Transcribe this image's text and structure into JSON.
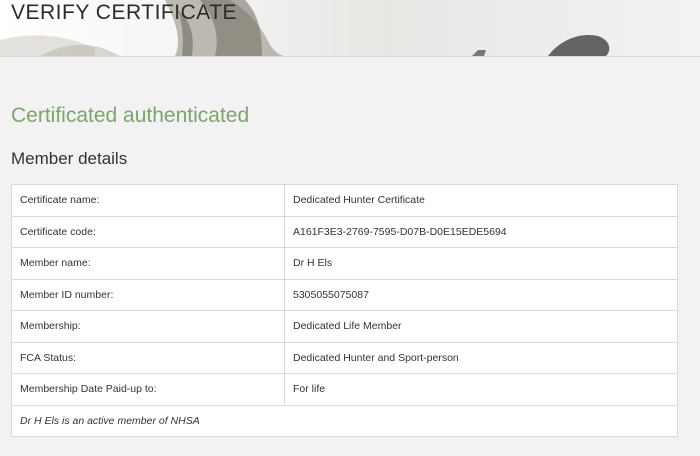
{
  "page": {
    "title": "VERIFY CERTIFICATE",
    "status_heading": "Certificated authenticated",
    "section_heading": "Member details"
  },
  "member_details": {
    "rows": [
      {
        "label": "Certificate name:",
        "value": "Dedicated Hunter Certificate"
      },
      {
        "label": "Certificate code:",
        "value": "A161F3E3-2769-7595-D07B-D0E15EDE5694"
      },
      {
        "label": "Member name:",
        "value": "Dr H Els"
      },
      {
        "label": "Member ID number:",
        "value": "5305055075087"
      },
      {
        "label": "Membership:",
        "value": "Dedicated Life Member"
      },
      {
        "label": "FCA Status:",
        "value": "Dedicated Hunter and Sport-person"
      },
      {
        "label": "Membership Date Paid-up to:",
        "value": "For life"
      }
    ],
    "footer_note": "Dr H Els is an active member of NHSA"
  },
  "colors": {
    "status_green": "#7ba766",
    "page_background": "#f2f2f2",
    "table_background": "#ffffff",
    "table_border": "#d9d9d9"
  }
}
